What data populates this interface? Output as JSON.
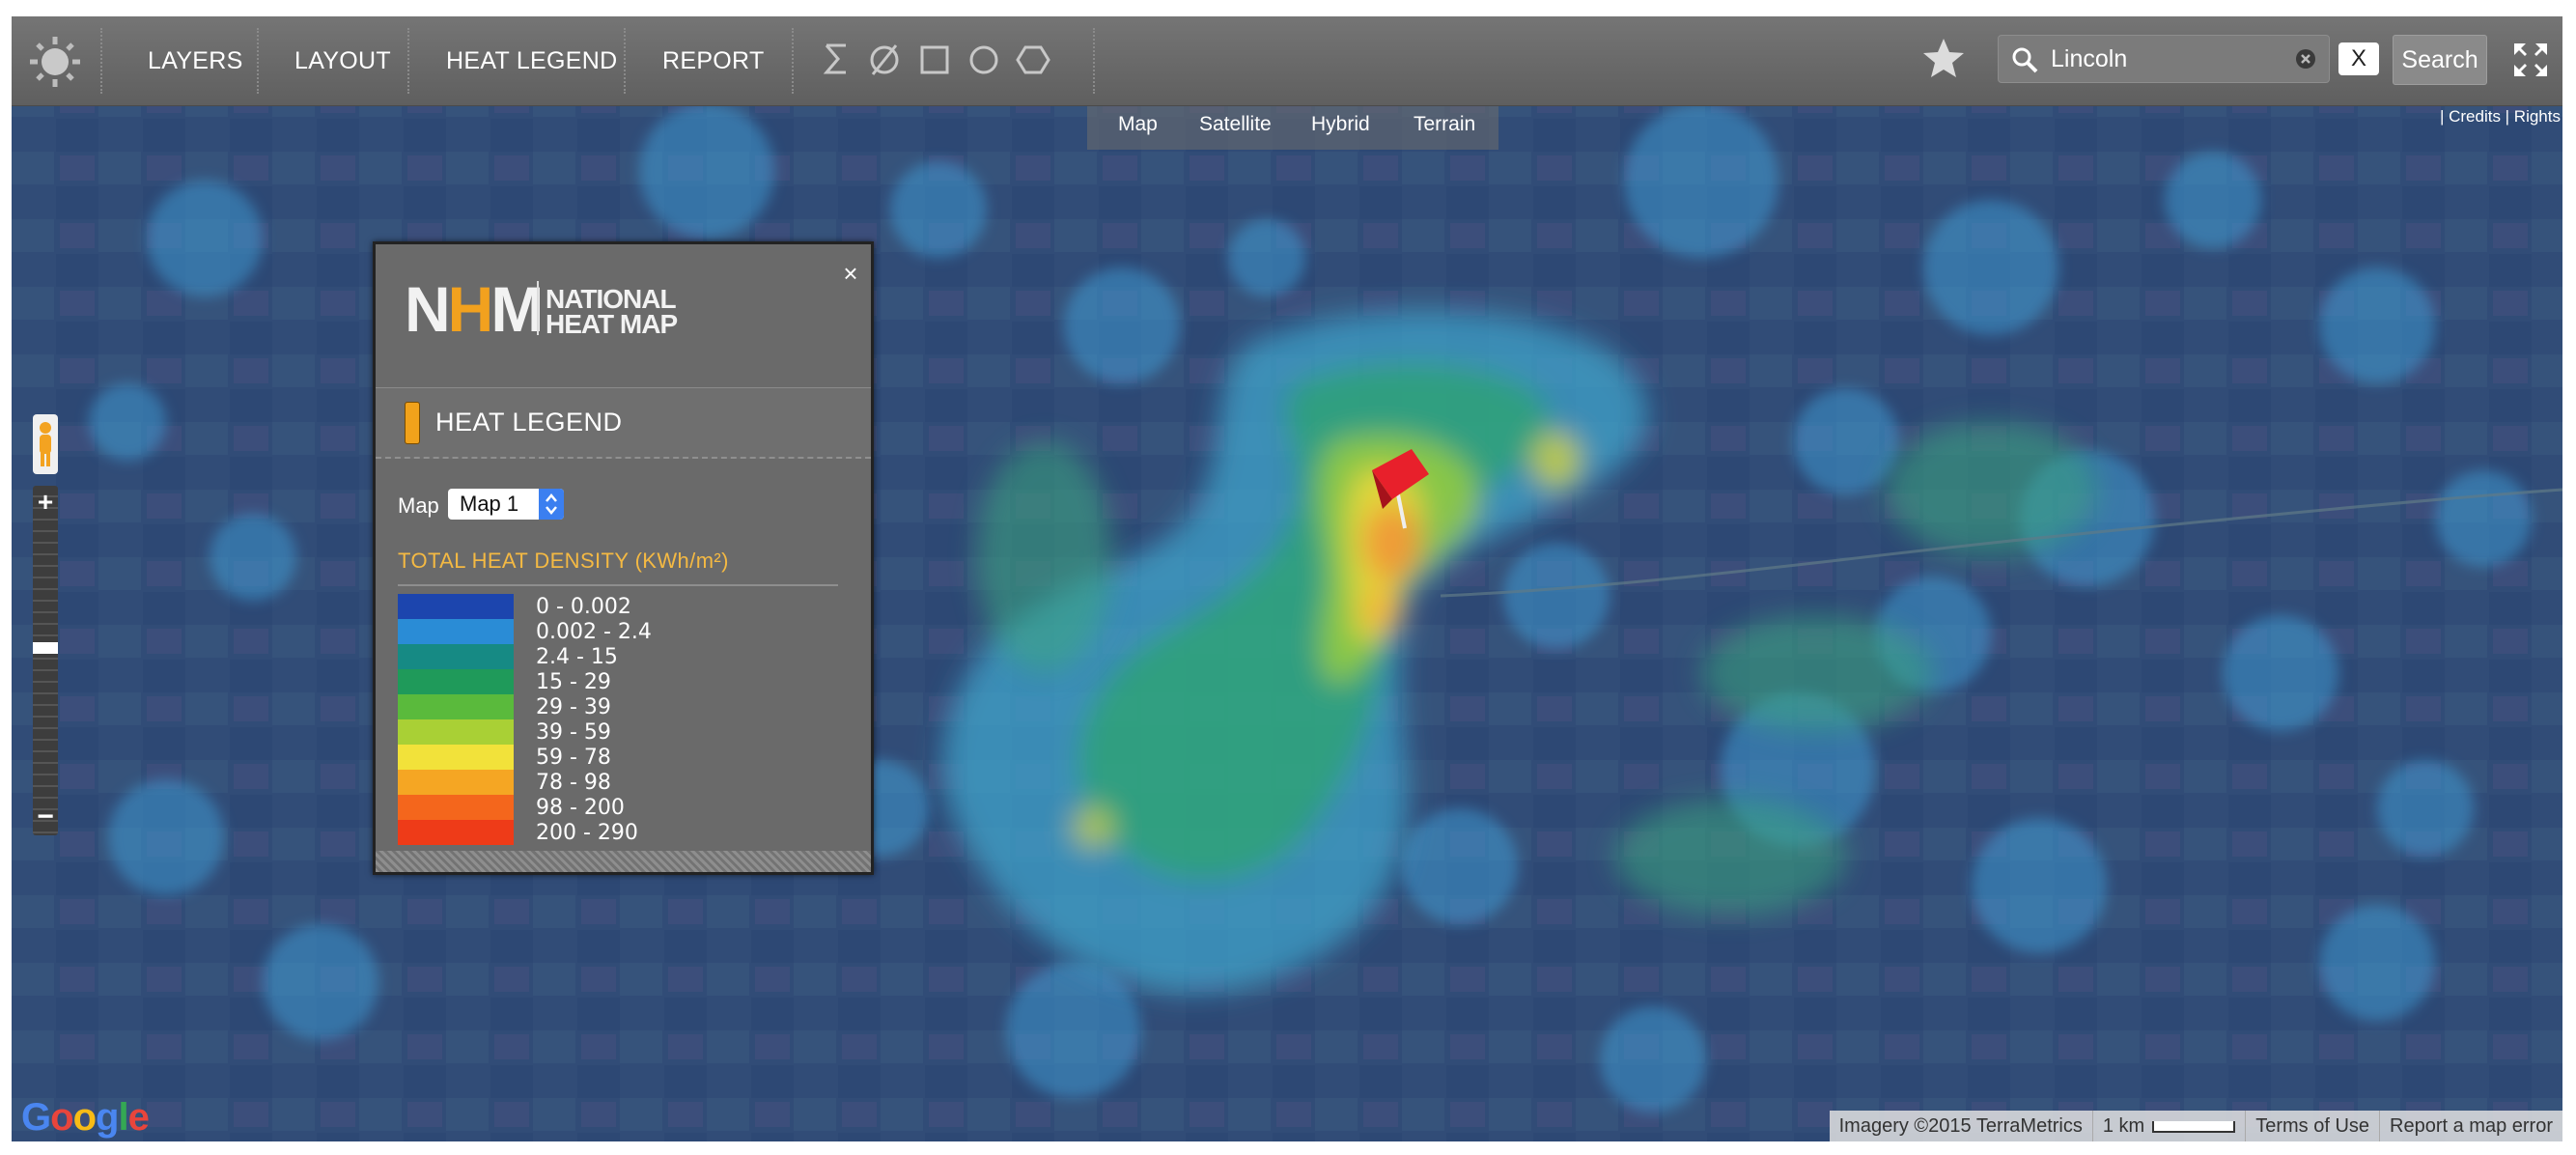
{
  "toolbar": {
    "menu": [
      {
        "label": "LAYERS"
      },
      {
        "label": "LAYOUT"
      },
      {
        "label": "HEAT LEGEND"
      },
      {
        "label": "REPORT"
      }
    ],
    "tools": [
      "sum-icon",
      "no-selection-icon",
      "square-icon",
      "circle-icon",
      "hexagon-icon"
    ],
    "search": {
      "value": "Lincoln",
      "x_label": "X",
      "button_label": "Search"
    }
  },
  "map": {
    "types": [
      "Map",
      "Satellite",
      "Hybrid",
      "Terrain"
    ],
    "credits": "| Credits | Rights",
    "google_logo": "Google",
    "footer": {
      "imagery": "Imagery ©2015 TerraMetrics",
      "scale": "1 km",
      "terms": "Terms of Use",
      "report": "Report a map error"
    },
    "zoom": {
      "in": "+",
      "out": "−"
    }
  },
  "legend": {
    "close": "×",
    "brand_letters": "NHM",
    "brand_line1": "NATIONAL",
    "brand_line2": "HEAT MAP",
    "title": "HEAT LEGEND",
    "map_label": "Map",
    "map_select": "Map 1",
    "density_title": "TOTAL HEAT DENSITY (KWh/m²)",
    "rows": [
      {
        "label": "0 - 0.002",
        "color": "#1c45ae"
      },
      {
        "label": "0.002 - 2.4",
        "color": "#2a8cd6"
      },
      {
        "label": "2.4 - 15",
        "color": "#168a84"
      },
      {
        "label": "15 - 29",
        "color": "#1f9a5a"
      },
      {
        "label": "29 - 39",
        "color": "#5aba3c"
      },
      {
        "label": "39 - 59",
        "color": "#a9d035"
      },
      {
        "label": "59 - 78",
        "color": "#f2e23a"
      },
      {
        "label": "78 - 98",
        "color": "#f5a623"
      },
      {
        "label": "98 - 200",
        "color": "#f4661c"
      },
      {
        "label": "200 - 290",
        "color": "#ee3b18"
      }
    ]
  },
  "colors": {
    "toolbar": "#6a6a6a",
    "legend_accent": "#f4b943",
    "flag": "#e8202b"
  }
}
